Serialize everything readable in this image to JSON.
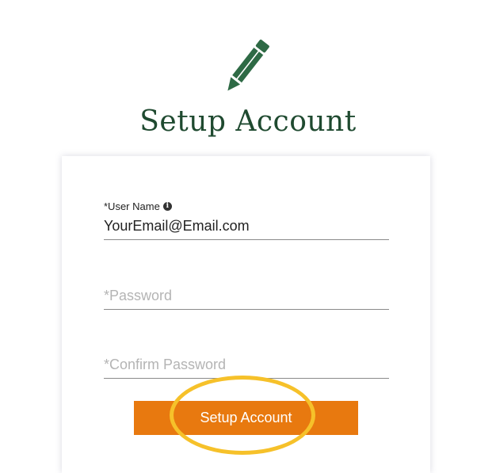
{
  "header": {
    "icon": "pencil-icon",
    "title": "Setup Account"
  },
  "form": {
    "username": {
      "label": "*User Name",
      "info_icon": "info-circle-icon",
      "value": "YourEmail@Email.com"
    },
    "password": {
      "placeholder": "*Password"
    },
    "confirm_password": {
      "placeholder": "*Confirm Password"
    },
    "submit_label": "Setup Account"
  },
  "colors": {
    "title": "#1f4a30",
    "pencil": "#2e6a45",
    "button": "#e8790f",
    "highlight_ring": "#f6c12a"
  }
}
